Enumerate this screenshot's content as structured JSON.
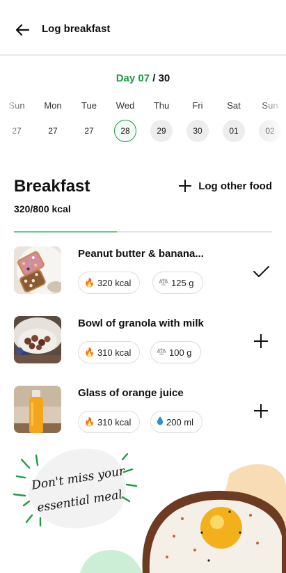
{
  "header": {
    "title": "Log breakfast",
    "back_icon": "arrow-left-icon"
  },
  "day_counter": {
    "current": "Day 07",
    "separator": "/",
    "total": "30"
  },
  "calendar": {
    "days": [
      {
        "name": "Sun",
        "num": "27",
        "state": "past"
      },
      {
        "name": "Mon",
        "num": "27",
        "state": "past"
      },
      {
        "name": "Tue",
        "num": "27",
        "state": "past"
      },
      {
        "name": "Wed",
        "num": "28",
        "state": "selected"
      },
      {
        "name": "Thu",
        "num": "29",
        "state": "future"
      },
      {
        "name": "Fri",
        "num": "30",
        "state": "future"
      },
      {
        "name": "Sat",
        "num": "01",
        "state": "future"
      },
      {
        "name": "Sun",
        "num": "02",
        "state": "future"
      }
    ],
    "selected_color": "#1e9a44"
  },
  "meal": {
    "title": "Breakfast",
    "kcal": "320/800 kcal",
    "progress": 0.4,
    "log_other_label": "Log other food"
  },
  "foods": [
    {
      "name": "Peanut butter & banana...",
      "kcal": "320 kcal",
      "amount": "125 g",
      "amount_icon": "scale-icon",
      "action": "check-icon",
      "image": "toast-image"
    },
    {
      "name": "Bowl of granola with milk",
      "kcal": "310 kcal",
      "amount": "100 g",
      "amount_icon": "scale-icon",
      "action": "plus-icon",
      "image": "granola-image"
    },
    {
      "name": "Glass of orange juice",
      "kcal": "310 kcal",
      "amount": "200 ml",
      "amount_icon": "droplet-icon",
      "action": "plus-icon",
      "image": "orange-juice-image"
    }
  ],
  "promo": {
    "line1": "Don't miss your",
    "line2": "essential meal"
  },
  "colors": {
    "accent": "#1e9a44",
    "progress": "#6ccb8a",
    "blob_orange": "#f8dcb5",
    "blob_green": "#cdeed6"
  }
}
